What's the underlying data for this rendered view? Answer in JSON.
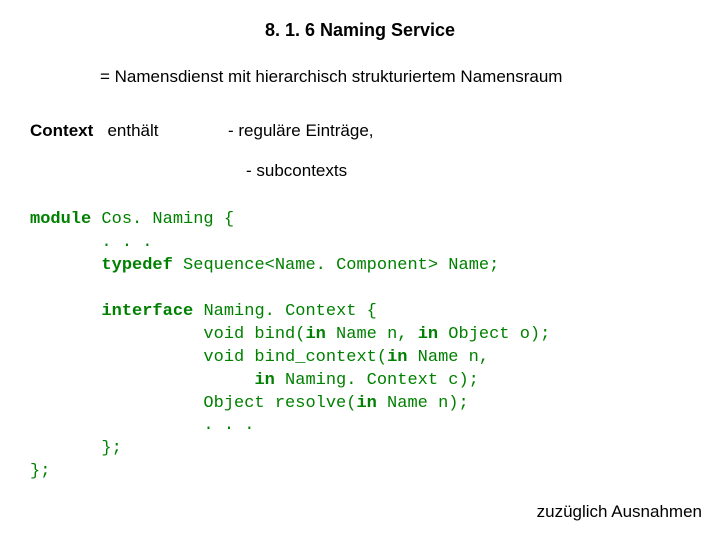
{
  "heading": "8. 1. 6  Naming Service",
  "subline": "= Namensdienst mit hierarchisch strukturiertem Namensraum",
  "context": {
    "label": "Context",
    "verb": "enthält",
    "item1": "-  reguläre Einträge,",
    "item2": "-  subcontexts"
  },
  "code": {
    "kw_module": "module",
    "module_rest": " Cos. Naming {",
    "dots1": "       . . .",
    "indent_typedef": "       ",
    "kw_typedef": "typedef",
    "typedef_rest": " Sequence<Name. Component> Name;",
    "blank": " ",
    "indent_interface": "       ",
    "kw_interface": "interface",
    "interface_rest": " Naming. Context {",
    "l_bind_a": "                 void bind(",
    "kw_in1": "in",
    "l_bind_b": " Name n, ",
    "kw_in2": "in",
    "l_bind_c": " Object o);",
    "l_bindctx_a": "                 void bind_context(",
    "kw_in3": "in",
    "l_bindctx_b": " Name n,",
    "l_bindctx2_a": "                      ",
    "kw_in4": "in",
    "l_bindctx2_b": " Naming. Context c);",
    "l_resolve_a": "                 Object resolve(",
    "kw_in5": "in",
    "l_resolve_b": " Name n);",
    "dots2": "                 . . .",
    "close_inner": "       };",
    "close_outer": "};"
  },
  "footer": "zuzüglich Ausnahmen"
}
